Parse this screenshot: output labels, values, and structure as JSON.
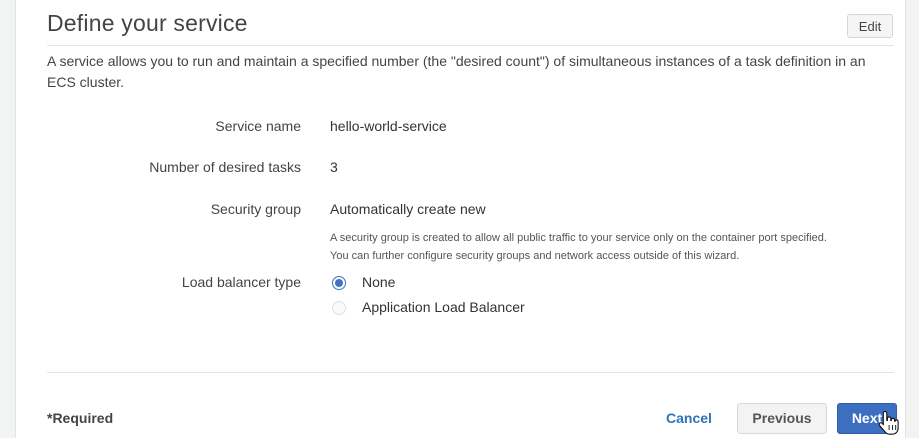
{
  "section": {
    "title": "Define your service",
    "edit_label": "Edit",
    "description": "A service allows you to run and maintain a specified number (the \"desired count\") of simultaneous instances of a task definition in an ECS cluster."
  },
  "fields": {
    "service_name": {
      "label": "Service name",
      "value": "hello-world-service"
    },
    "desired_tasks": {
      "label": "Number of desired tasks",
      "value": "3"
    },
    "security_group": {
      "label": "Security group",
      "value": "Automatically create new",
      "note_line1": "A security group is created to allow all public traffic to your service only on the container port specified.",
      "note_line2": "You can further configure security groups and network access outside of this wizard."
    },
    "load_balancer": {
      "label": "Load balancer type",
      "options": [
        {
          "label": "None",
          "selected": true
        },
        {
          "label": "Application Load Balancer",
          "selected": false
        }
      ]
    }
  },
  "footer": {
    "required_label": "*Required",
    "cancel_label": "Cancel",
    "previous_label": "Previous",
    "next_label": "Next"
  },
  "colors": {
    "primary_button": "#3d6fc0",
    "link": "#2e73b8",
    "radio_selected": "#3d74c4"
  },
  "icons": {
    "cursor": "hand-pointer-icon"
  }
}
